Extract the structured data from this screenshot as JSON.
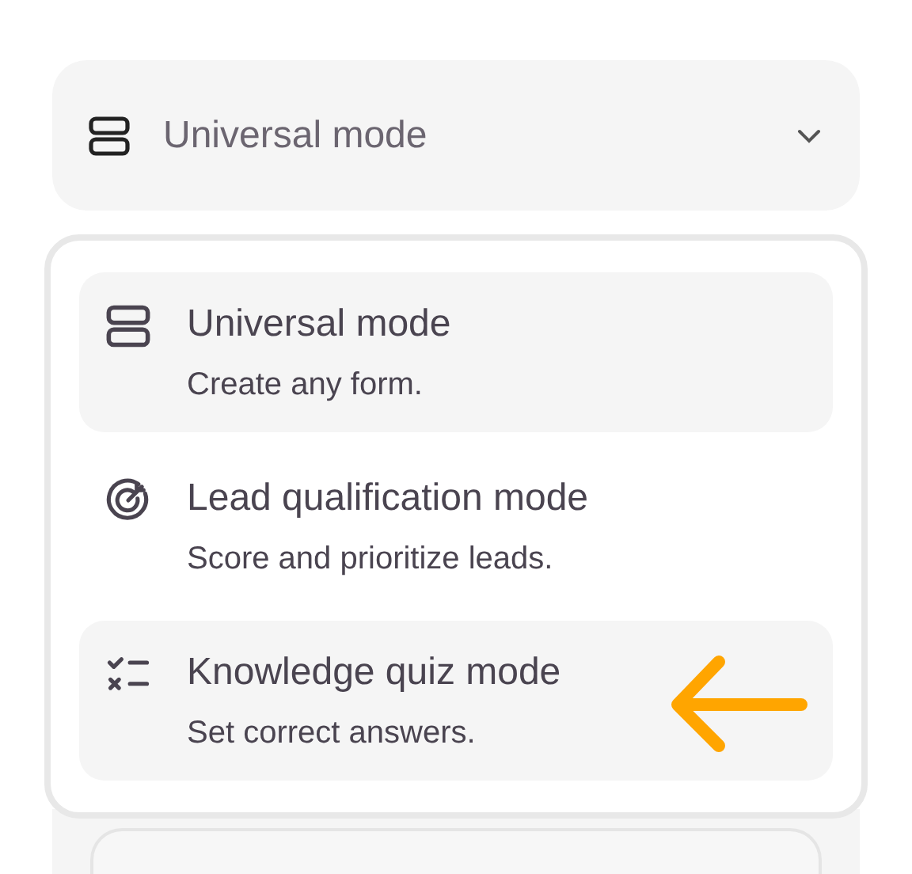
{
  "select": {
    "value": "Universal mode",
    "expanded": true
  },
  "options": [
    {
      "kind": "universal",
      "title": "Universal mode",
      "description": "Create any form.",
      "highlighted": true,
      "arrow": false
    },
    {
      "kind": "lead",
      "title": "Lead qualification mode",
      "description": "Score and prioritize leads.",
      "highlighted": false,
      "arrow": false
    },
    {
      "kind": "quiz",
      "title": "Knowledge quiz mode",
      "description": "Set correct answers.",
      "highlighted": true,
      "arrow": true
    }
  ]
}
